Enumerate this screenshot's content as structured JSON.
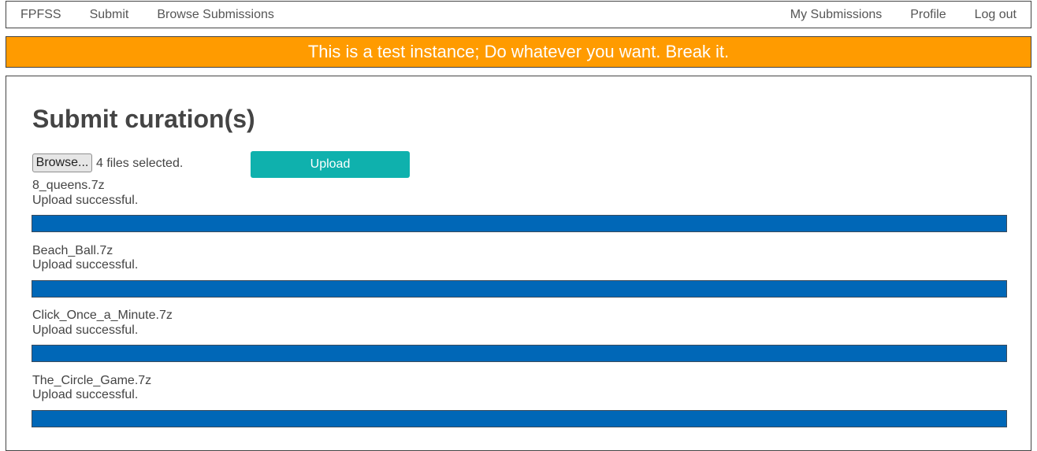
{
  "nav": {
    "left": [
      "FPFSS",
      "Submit",
      "Browse Submissions"
    ],
    "right": [
      "My Submissions",
      "Profile",
      "Log out"
    ]
  },
  "banner": {
    "text": "This is a test instance; Do whatever you want. Break it.",
    "color": "#ff9b00"
  },
  "main": {
    "title": "Submit curation(s)",
    "browse_label": "Browse...",
    "files_selected": "4 files selected.",
    "upload_label": "Upload",
    "upload_color": "#0fb1ad",
    "progress_color": "#0067b7",
    "uploads": [
      {
        "name": "8_queens.7z",
        "status": "Upload successful.",
        "progress": 1.0
      },
      {
        "name": "Beach_Ball.7z",
        "status": "Upload successful.",
        "progress": 1.0
      },
      {
        "name": "Click_Once_a_Minute.7z",
        "status": "Upload successful.",
        "progress": 1.0
      },
      {
        "name": "The_Circle_Game.7z",
        "status": "Upload successful.",
        "progress": 1.0
      }
    ]
  }
}
